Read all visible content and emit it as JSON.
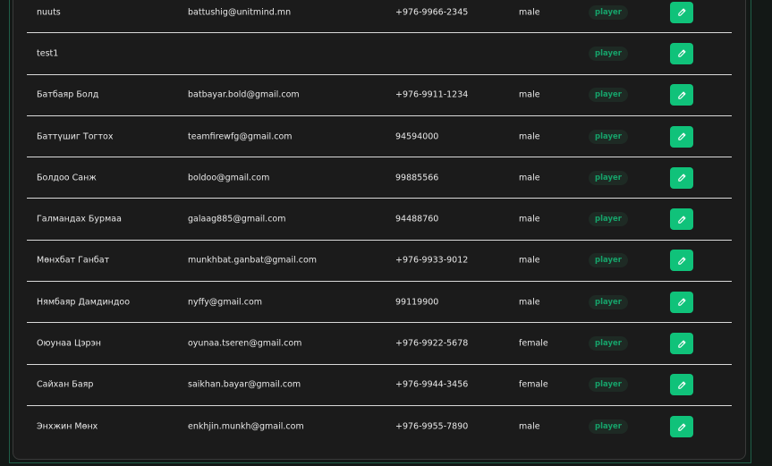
{
  "colors": {
    "background": "#131816",
    "card": "#1b1b1b",
    "accent": "#10c27a",
    "badge_text": "#16a36a",
    "badge_bg": "#1e2a24",
    "divider": "#d9d9d9"
  },
  "users": [
    {
      "name": "nuuts",
      "email": "battushig@unitmind.mn",
      "phone": "+976-9966-2345",
      "gender": "male",
      "role": "player",
      "edit_icon": "pencil-icon"
    },
    {
      "name": "test1",
      "email": "",
      "phone": "",
      "gender": "",
      "role": "player",
      "edit_icon": "pencil-icon"
    },
    {
      "name": "Батбаяр Болд",
      "email": "batbayar.bold@gmail.com",
      "phone": "+976-9911-1234",
      "gender": "male",
      "role": "player",
      "edit_icon": "pencil-icon"
    },
    {
      "name": "Баттүшиг Тогтох",
      "email": "teamfirewfg@gmail.com",
      "phone": "94594000",
      "gender": "male",
      "role": "player",
      "edit_icon": "pencil-icon"
    },
    {
      "name": "Болдоо Санж",
      "email": "boldoo@gmail.com",
      "phone": "99885566",
      "gender": "male",
      "role": "player",
      "edit_icon": "pencil-icon"
    },
    {
      "name": "Галмандах Бурмаа",
      "email": "galaag885@gmail.com",
      "phone": "94488760",
      "gender": "male",
      "role": "player",
      "edit_icon": "pencil-icon"
    },
    {
      "name": "Мөнхбат Ганбат",
      "email": "munkhbat.ganbat@gmail.com",
      "phone": "+976-9933-9012",
      "gender": "male",
      "role": "player",
      "edit_icon": "pencil-icon"
    },
    {
      "name": "Нямбаяр Дамдиндоо",
      "email": "nyffy@gmail.com",
      "phone": "99119900",
      "gender": "male",
      "role": "player",
      "edit_icon": "pencil-icon"
    },
    {
      "name": "Оюунаа Цэрэн",
      "email": "oyunaa.tseren@gmail.com",
      "phone": "+976-9922-5678",
      "gender": "female",
      "role": "player",
      "edit_icon": "pencil-icon"
    },
    {
      "name": "Сайхан Баяр",
      "email": "saikhan.bayar@gmail.com",
      "phone": "+976-9944-3456",
      "gender": "female",
      "role": "player",
      "edit_icon": "pencil-icon"
    },
    {
      "name": "Энхжин Мөнх",
      "email": "enkhjin.munkh@gmail.com",
      "phone": "+976-9955-7890",
      "gender": "male",
      "role": "player",
      "edit_icon": "pencil-icon"
    }
  ]
}
